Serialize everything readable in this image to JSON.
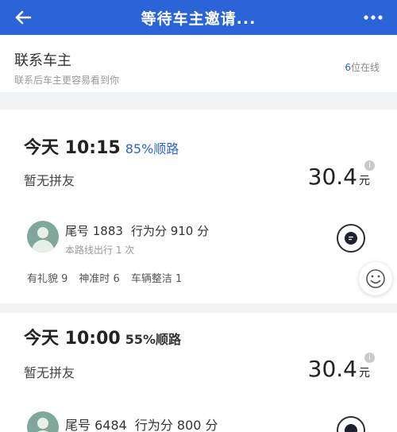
{
  "header": {
    "title": "等待车主邀请...",
    "back_icon": "arrow-left-icon",
    "more_icon": "more-dots-icon"
  },
  "contact": {
    "title": "联系车主",
    "subtitle": "联系后车主更容易看到你",
    "online_count": "6",
    "online_suffix": "位在线"
  },
  "offers": [
    {
      "time": "今天 10:15",
      "match": "85%顺路",
      "mates": "暂无拼友",
      "price": "30.4",
      "unit": "元",
      "driver": {
        "tail": "尾号 1883",
        "score": "行为分 910 分",
        "trips": "本路线出行 1 次"
      },
      "tags": [
        "有礼貌 9",
        "神准时 6",
        "车辆整洁 1"
      ]
    },
    {
      "time": "今天 10:00",
      "match": "55%顺路",
      "mates": "暂无拼友",
      "price": "30.4",
      "unit": "元",
      "driver": {
        "tail": "尾号 6484",
        "score": "行为分 800 分"
      }
    }
  ],
  "colors": {
    "brand": "#2b63d9",
    "background": "#f3f4f6"
  }
}
